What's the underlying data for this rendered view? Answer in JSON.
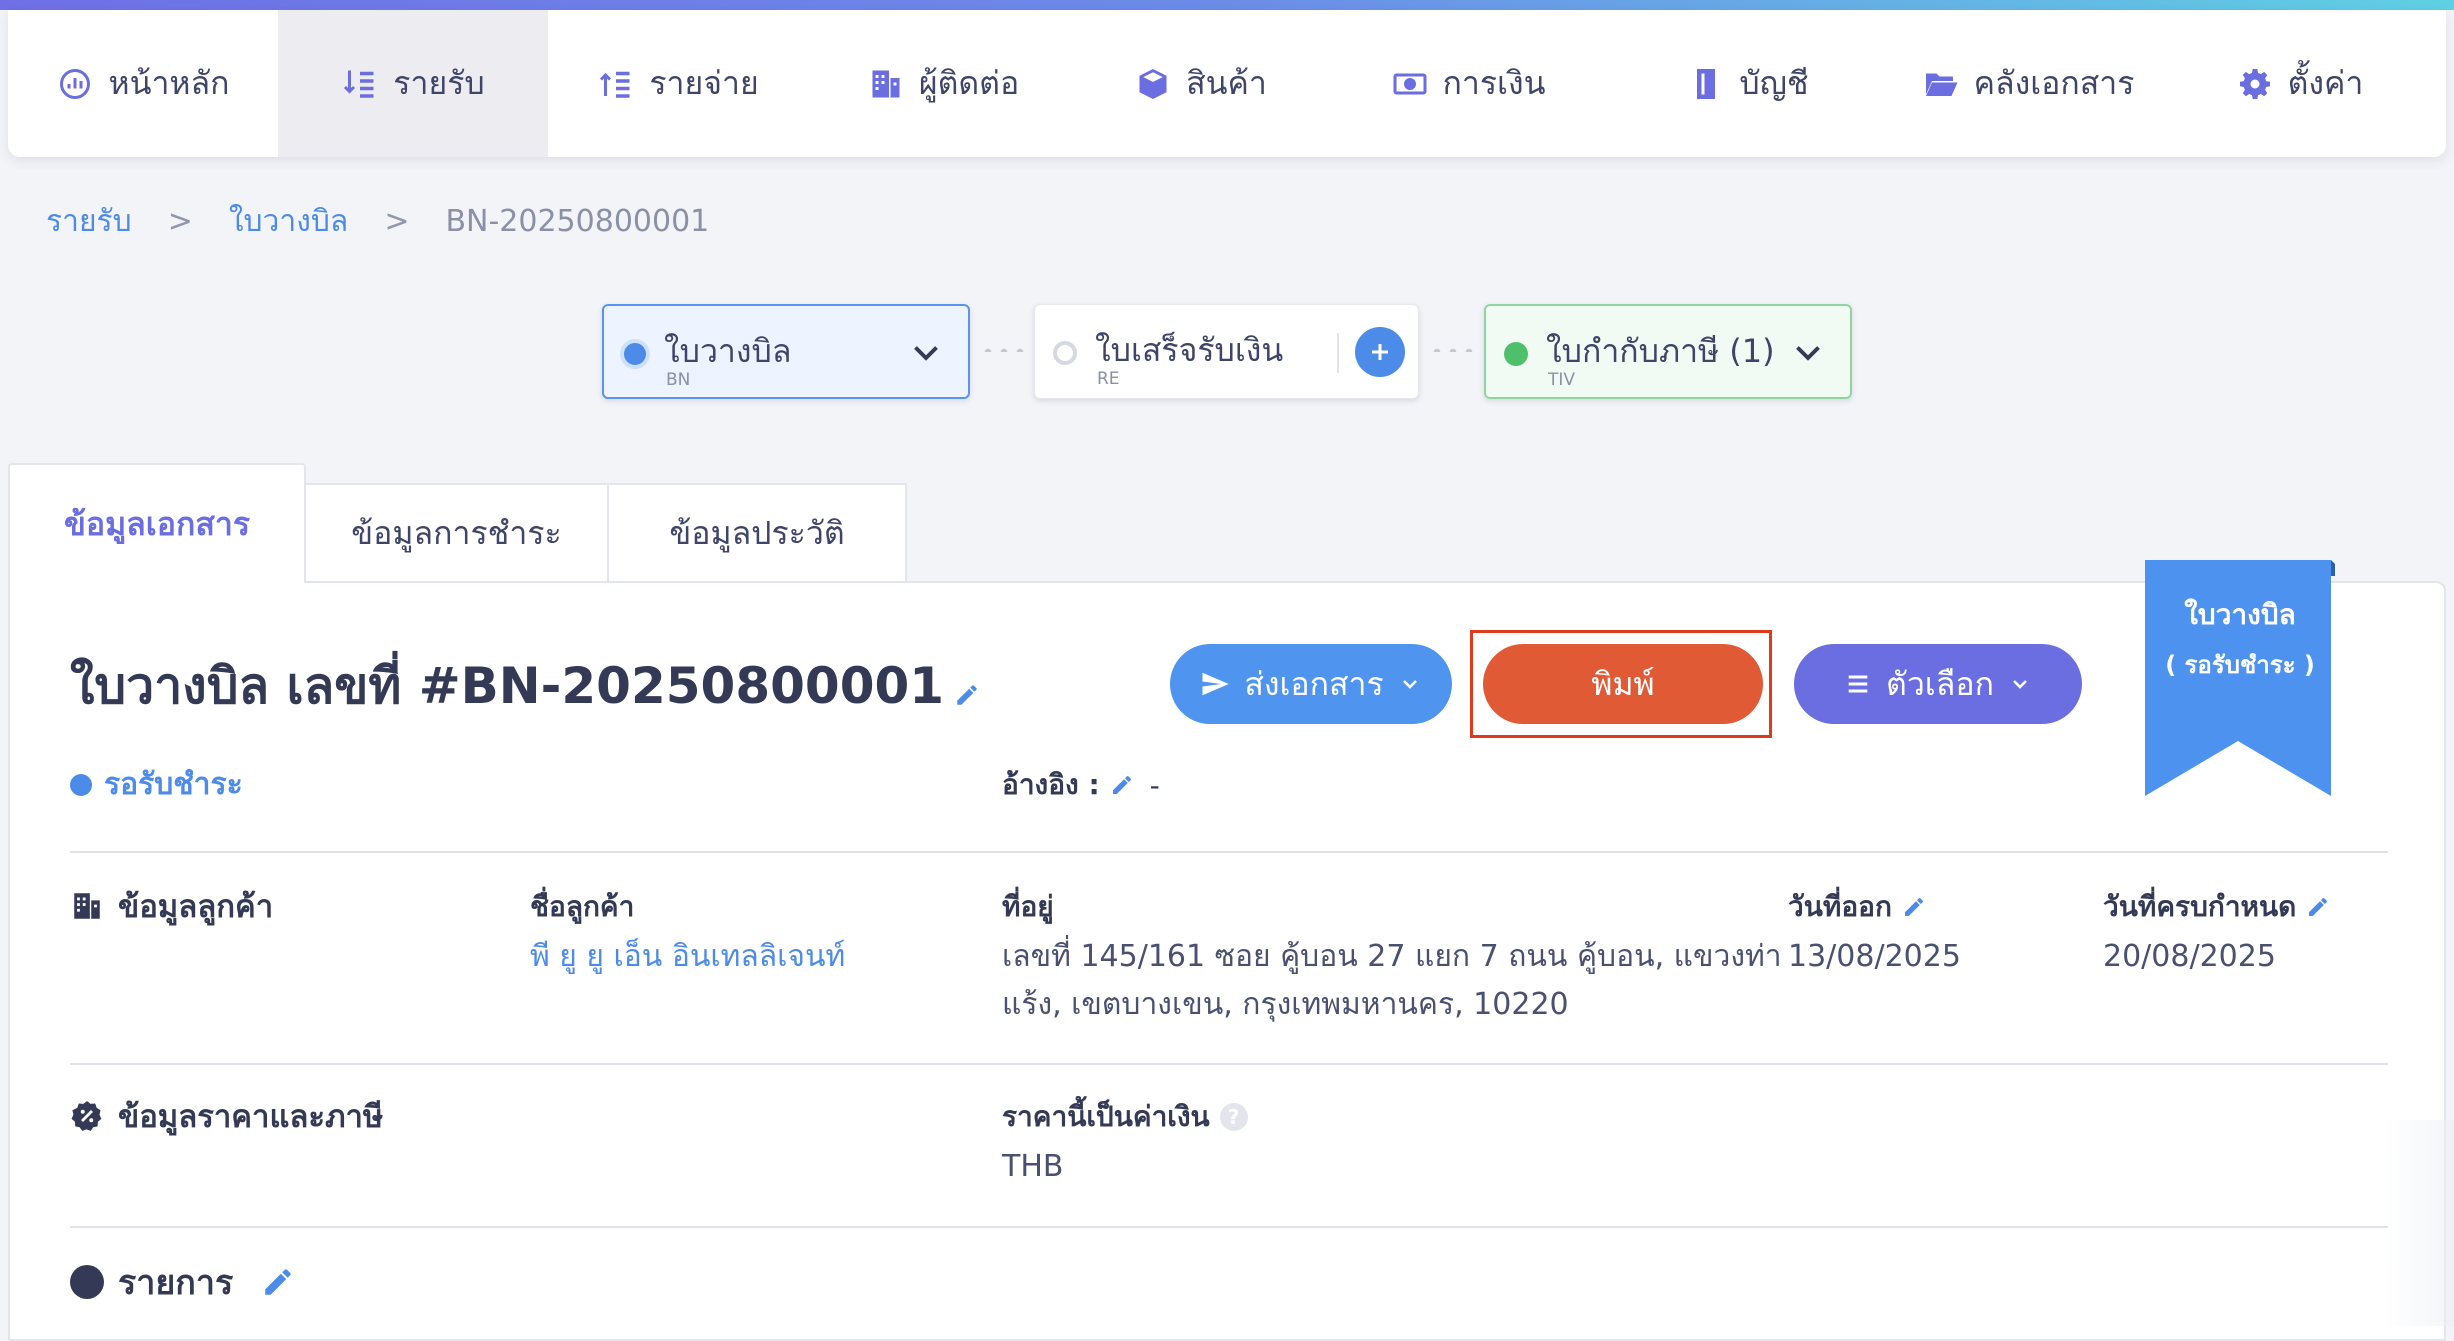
{
  "nav": {
    "items": [
      {
        "label": "หน้าหลัก",
        "icon": "dashboard-gauge-icon",
        "active": false
      },
      {
        "label": "รายรับ",
        "icon": "income-icon",
        "active": true
      },
      {
        "label": "รายจ่าย",
        "icon": "expense-icon",
        "active": false
      },
      {
        "label": "ผู้ติดต่อ",
        "icon": "contacts-building-icon",
        "active": false
      },
      {
        "label": "สินค้า",
        "icon": "product-box-icon",
        "active": false
      },
      {
        "label": "การเงิน",
        "icon": "money-icon",
        "active": false
      },
      {
        "label": "บัญชี",
        "icon": "account-book-icon",
        "active": false
      },
      {
        "label": "คลังเอกสาร",
        "icon": "folder-open-icon",
        "active": false
      },
      {
        "label": "ตั้งค่า",
        "icon": "gear-icon",
        "active": false
      }
    ]
  },
  "breadcrumb": {
    "level1": "รายรับ",
    "sep1": ">",
    "level2": "ใบวางบิล",
    "sep2": ">",
    "current": "BN-20250800001"
  },
  "workflow": {
    "bn": {
      "label": "ใบวางบิล",
      "code": "BN"
    },
    "re": {
      "label": "ใบเสร็จรับเงิน",
      "code": "RE",
      "add": "+"
    },
    "tiv": {
      "label": "ใบกำกับภาษี (1)",
      "code": "TIV"
    }
  },
  "tabs": {
    "doc_info": "ข้อมูลเอกสาร",
    "payment_info": "ข้อมูลการชำระ",
    "history_info": "ข้อมูลประวัติ"
  },
  "document": {
    "title": "ใบวางบิล เลขที่ #BN-20250800001",
    "status": "รอรับชำระ",
    "reference_label": "อ้างอิง :",
    "reference_value": "-",
    "ribbon_line1": "ใบวางบิล",
    "ribbon_line2": "( รอรับชำระ )"
  },
  "actions": {
    "send": "ส่งเอกสาร",
    "print": "พิมพ์",
    "options": "ตัวเลือก"
  },
  "customer": {
    "section_title": "ข้อมูลลูกค้า",
    "name_label": "ชื่อลูกค้า",
    "name_value": "พี ยู ยู เอ็น อินเทลลิเจนท์",
    "address_label": "ที่อยู่",
    "address_line1": "เลขที่ 145/161 ซอย คู้บอน 27 แยก 7 ถนน คู้บอน, แขวงท่า",
    "address_line2": "แร้ง, เขตบางเขน, กรุงเทพมหานคร, 10220",
    "issue_date_label": "วันที่ออก",
    "issue_date_value": "13/08/2025",
    "due_date_label": "วันที่ครบกำหนด",
    "due_date_value": "20/08/2025"
  },
  "pricing": {
    "section_title": "ข้อมูลราคาและภาษี",
    "currency_label": "ราคานี้เป็นค่าเงิน",
    "currency_value": "THB",
    "help": "?"
  },
  "items": {
    "section_title": "รายการ"
  },
  "colors": {
    "accent_blue": "#4d8be8",
    "print_orange": "#e05a36",
    "options_purple": "#6b6ee0",
    "status_green": "#4fbf6b",
    "highlight_red": "#e03a1c"
  }
}
